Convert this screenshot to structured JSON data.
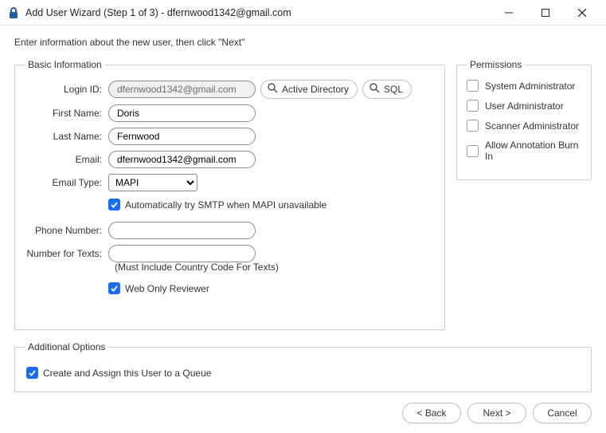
{
  "window": {
    "title": "Add User Wizard (Step 1 of 3) - dfernwood1342@gmail.com"
  },
  "instruction": "Enter information about the new user, then click \"Next\"",
  "basic": {
    "legend": "Basic Information",
    "labels": {
      "loginId": "Login ID:",
      "firstName": "First Name:",
      "lastName": "Last Name:",
      "email": "Email:",
      "emailType": "Email Type:",
      "phone": "Phone Number:",
      "texts": "Number for Texts:"
    },
    "values": {
      "loginId": "dfernwood1342@gmail.com",
      "firstName": "Doris",
      "lastName": "Fernwood",
      "email": "dfernwood1342@gmail.com",
      "emailType": "MAPI",
      "phone": "",
      "texts": ""
    },
    "buttons": {
      "activeDirectory": "Active Directory",
      "sql": "SQL"
    },
    "smtpFallback": "Automatically try SMTP when MAPI unavailable",
    "textsNote": "(Must Include Country Code For Texts)",
    "webOnly": "Web Only Reviewer"
  },
  "permissions": {
    "legend": "Permissions",
    "items": [
      "System Administrator",
      "User Administrator",
      "Scanner Administrator",
      "Allow Annotation Burn In"
    ]
  },
  "additional": {
    "legend": "Additional Options",
    "assignQueue": "Create and Assign this User to a Queue"
  },
  "footer": {
    "back": "< Back",
    "next": "Next >",
    "cancel": "Cancel"
  }
}
